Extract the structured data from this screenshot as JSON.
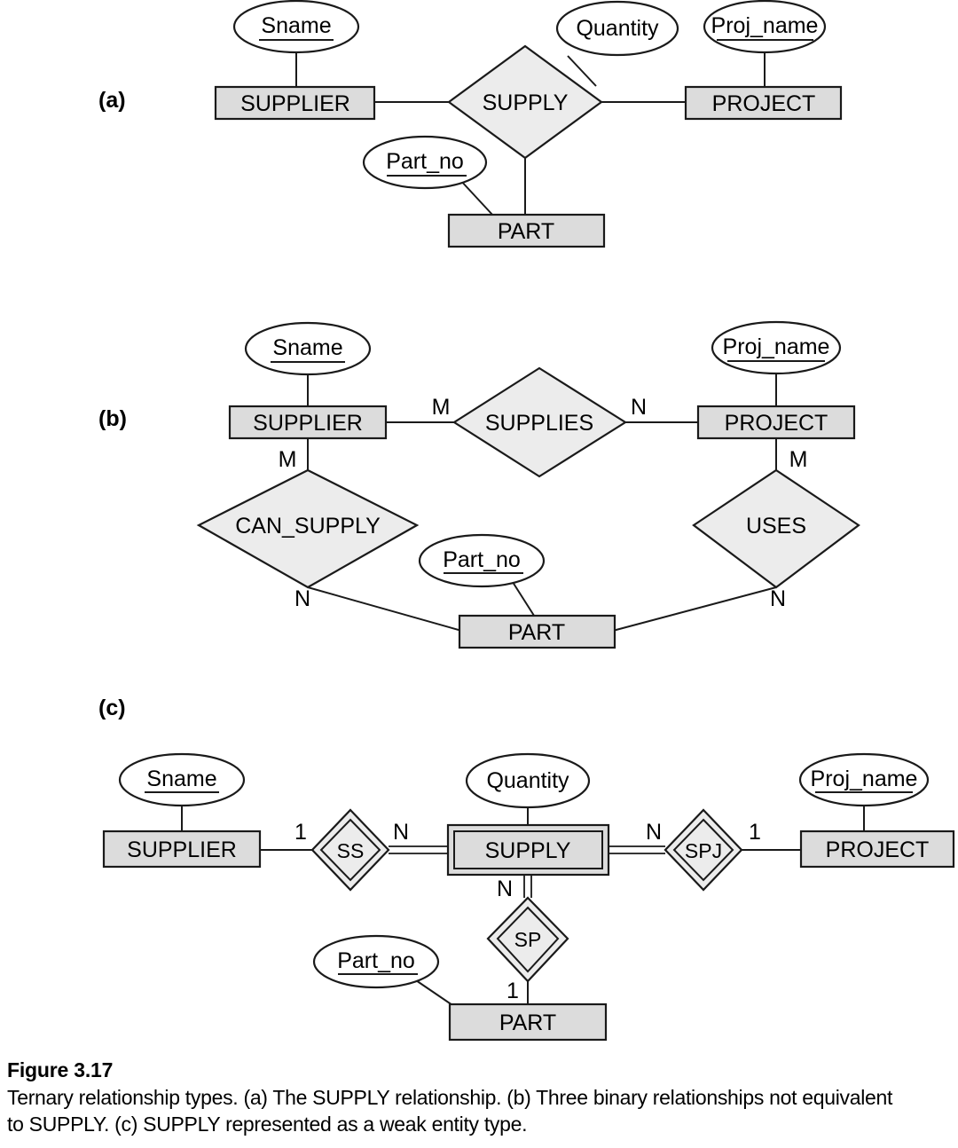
{
  "figure": {
    "number": "Figure 3.17",
    "caption": "Ternary relationship types. (a) The SUPPLY relationship. (b) Three binary relationships not equivalent to SUPPLY. (c) SUPPLY represented as a weak entity type."
  },
  "colors": {
    "entity_fill": "#dcdcdc",
    "relationship_fill": "#ececec",
    "attribute_fill": "#ffffff",
    "stroke": "#1a1a1a",
    "background": "#ffffff"
  },
  "panels": {
    "a": {
      "label": "(a)",
      "entities": [
        {
          "name": "SUPPLIER"
        },
        {
          "name": "PROJECT"
        },
        {
          "name": "PART"
        }
      ],
      "relationships": [
        {
          "name": "SUPPLY",
          "kind": "ternary"
        }
      ],
      "attributes": [
        {
          "name": "Sname",
          "key": true,
          "owner": "SUPPLIER"
        },
        {
          "name": "Proj_name",
          "key": true,
          "owner": "PROJECT"
        },
        {
          "name": "Part_no",
          "key": true,
          "owner": "PART"
        },
        {
          "name": "Quantity",
          "key": false,
          "owner": "SUPPLY"
        }
      ]
    },
    "b": {
      "label": "(b)",
      "entities": [
        {
          "name": "SUPPLIER"
        },
        {
          "name": "PROJECT"
        },
        {
          "name": "PART"
        }
      ],
      "relationships": [
        {
          "name": "SUPPLIES",
          "left_card": "M",
          "right_card": "N"
        },
        {
          "name": "CAN_SUPPLY",
          "left_card": "M",
          "right_card": "N"
        },
        {
          "name": "USES",
          "left_card": "M",
          "right_card": "N"
        }
      ],
      "attributes": [
        {
          "name": "Sname",
          "key": true,
          "owner": "SUPPLIER"
        },
        {
          "name": "Proj_name",
          "key": true,
          "owner": "PROJECT"
        },
        {
          "name": "Part_no",
          "key": true,
          "owner": "PART"
        }
      ],
      "cardinalities": {
        "supplier_supplies": "M",
        "supplies_project": "N",
        "supplier_can_supply": "M",
        "can_supply_part": "N",
        "project_uses": "M",
        "uses_part": "N"
      }
    },
    "c": {
      "label": "(c)",
      "entities": [
        {
          "name": "SUPPLIER",
          "weak": false
        },
        {
          "name": "SUPPLY",
          "weak": true
        },
        {
          "name": "PROJECT",
          "weak": false
        },
        {
          "name": "PART",
          "weak": false
        }
      ],
      "relationships": [
        {
          "name": "SS",
          "identifying": true
        },
        {
          "name": "SPJ",
          "identifying": true
        },
        {
          "name": "SP",
          "identifying": true
        }
      ],
      "attributes": [
        {
          "name": "Sname",
          "key": true,
          "owner": "SUPPLIER"
        },
        {
          "name": "Quantity",
          "key": false,
          "owner": "SUPPLY"
        },
        {
          "name": "Proj_name",
          "key": true,
          "owner": "PROJECT"
        },
        {
          "name": "Part_no",
          "key": true,
          "owner": "PART"
        }
      ],
      "cardinalities": {
        "supplier_ss": "1",
        "ss_supply": "N",
        "supply_spj": "N",
        "spj_project": "1",
        "supply_sp": "N",
        "sp_part": "1"
      }
    }
  }
}
